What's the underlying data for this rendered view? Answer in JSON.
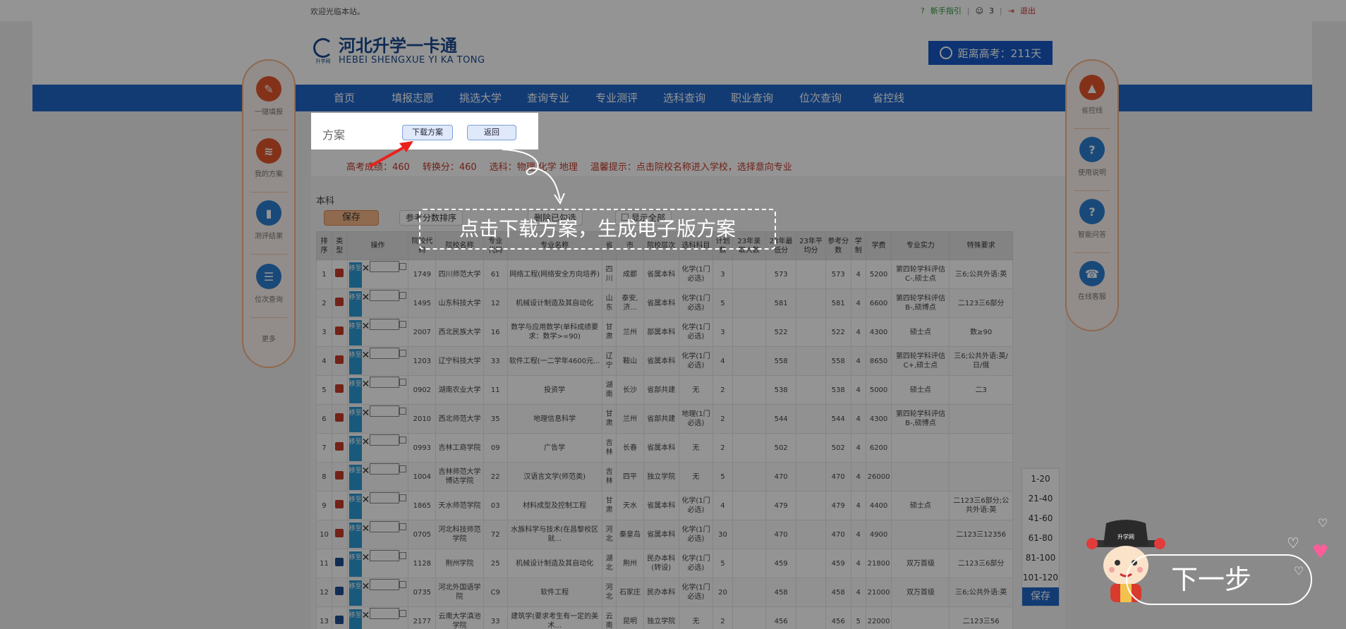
{
  "topbar": {
    "welcome": "欢迎光临本站。",
    "help": "新手指引",
    "separator": "|",
    "user_count": "3",
    "logout": "退出"
  },
  "brand": {
    "name_cn": "河北升学一卡通",
    "name_en": "HEBEI SHENGXUE YI KA TONG",
    "tagline": "升学网"
  },
  "countdown": {
    "label": "距离高考：211天"
  },
  "nav": [
    "首页",
    "填报志愿",
    "挑选大学",
    "查询专业",
    "专业测评",
    "选科查询",
    "职业查询",
    "位次查询",
    "省控线"
  ],
  "left_sidebar": [
    {
      "label": "一键填报",
      "icon": "fill-form-icon",
      "color": "#e2572b"
    },
    {
      "label": "我的方案",
      "icon": "layers-icon",
      "color": "#e2572b"
    },
    {
      "label": "测评结果",
      "icon": "bar-chart-icon",
      "color": "#2b7fd0"
    },
    {
      "label": "位次查询",
      "icon": "list-icon",
      "color": "#2b7fd0"
    },
    {
      "label": "更多",
      "icon": "",
      "color": ""
    }
  ],
  "right_sidebar": [
    {
      "label": "省控线",
      "icon": "chart-icon",
      "color": "#e2572b"
    },
    {
      "label": "使用说明",
      "icon": "question-icon",
      "color": "#2b7fd0"
    },
    {
      "label": "智能问答",
      "icon": "help-icon",
      "color": "#2b7fd0"
    },
    {
      "label": "在线客服",
      "icon": "headset-icon",
      "color": "#2b7fd0"
    }
  ],
  "plan": {
    "title": "方案",
    "download_label": "下载方案",
    "back_label": "返回"
  },
  "info": {
    "score": "高考成绩：460",
    "converted": "转换分：460",
    "subjects": "选科：物理 化学 地理",
    "hint": "温馨提示：点击院校名称进入学校，选择意向专业"
  },
  "section": {
    "title": "本科",
    "save_label": "保存",
    "btn2": "参考分数排序",
    "btn3": "删除已勾选",
    "btn4": "显示全部"
  },
  "table": {
    "headers": [
      "排序",
      "类型",
      "操作",
      "院校代码",
      "院校名称",
      "专业代码",
      "专业名称",
      "省",
      "市",
      "院校层次",
      "选科科目",
      "计划数",
      "23年录取人数",
      "23年最低分",
      "23年平均分",
      "参考分数",
      "学制",
      "学费",
      "专业实力",
      "特殊要求"
    ],
    "move_label": "移至",
    "rows": [
      {
        "rank": "1",
        "type": "r",
        "code": "1749",
        "school": "四川师范大学",
        "mcode": "61",
        "major": "网络工程(网络安全方向培养)",
        "prov": "四川",
        "city": "成都",
        "level": "省属本科",
        "subj": "化学(1门必选)",
        "plan": "3",
        "admit": "",
        "min": "573",
        "avg": "",
        "ref": "573",
        "years": "4",
        "fee": "5200",
        "strength": "第四轮学科评估C-,硕士点",
        "req": "三6;公共外语:英"
      },
      {
        "rank": "2",
        "type": "r",
        "code": "1495",
        "school": "山东科技大学",
        "mcode": "12",
        "major": "机械设计制造及其自动化",
        "prov": "山东",
        "city": "泰安,济...",
        "level": "省属本科",
        "subj": "化学(1门必选)",
        "plan": "5",
        "admit": "",
        "min": "581",
        "avg": "",
        "ref": "581",
        "years": "4",
        "fee": "6600",
        "strength": "第四轮学科评估B-,硕博点",
        "req": "二123三6部分"
      },
      {
        "rank": "3",
        "type": "r",
        "code": "2007",
        "school": "西北民族大学",
        "mcode": "16",
        "major": "数学与应用数学(单科成绩要求：数学>=90)",
        "prov": "甘肃",
        "city": "兰州",
        "level": "部属本科",
        "subj": "化学(1门必选)",
        "plan": "3",
        "admit": "",
        "min": "522",
        "avg": "",
        "ref": "522",
        "years": "4",
        "fee": "4300",
        "strength": "硕士点",
        "req": "数≥90"
      },
      {
        "rank": "4",
        "type": "r",
        "code": "1203",
        "school": "辽宁科技大学",
        "mcode": "33",
        "major": "软件工程(一二学年4600元...",
        "prov": "辽宁",
        "city": "鞍山",
        "level": "省属本科",
        "subj": "化学(1门必选)",
        "plan": "4",
        "admit": "",
        "min": "558",
        "avg": "",
        "ref": "558",
        "years": "4",
        "fee": "8650",
        "strength": "第四轮学科评估C+,硕士点",
        "req": "三6;公共外语:英/日/俄"
      },
      {
        "rank": "5",
        "type": "r",
        "code": "0902",
        "school": "湖南农业大学",
        "mcode": "11",
        "major": "投资学",
        "prov": "湖南",
        "city": "长沙",
        "level": "省部共建",
        "subj": "无",
        "plan": "2",
        "admit": "",
        "min": "538",
        "avg": "",
        "ref": "538",
        "years": "4",
        "fee": "5000",
        "strength": "硕士点",
        "req": "二3"
      },
      {
        "rank": "6",
        "type": "r",
        "code": "2010",
        "school": "西北师范大学",
        "mcode": "35",
        "major": "地理信息科学",
        "prov": "甘肃",
        "city": "兰州",
        "level": "省部共建",
        "subj": "地理(1门必选)",
        "plan": "2",
        "admit": "",
        "min": "544",
        "avg": "",
        "ref": "544",
        "years": "4",
        "fee": "4300",
        "strength": "第四轮学科评估B-,硕博点",
        "req": ""
      },
      {
        "rank": "7",
        "type": "r",
        "code": "0993",
        "school": "吉林工商学院",
        "mcode": "09",
        "major": "广告学",
        "prov": "吉林",
        "city": "长春",
        "level": "省属本科",
        "subj": "无",
        "plan": "2",
        "admit": "",
        "min": "502",
        "avg": "",
        "ref": "502",
        "years": "4",
        "fee": "6200",
        "strength": "",
        "req": ""
      },
      {
        "rank": "8",
        "type": "r",
        "code": "1004",
        "school": "吉林师范大学博达学院",
        "mcode": "22",
        "major": "汉语言文学(师范类)",
        "prov": "吉林",
        "city": "四平",
        "level": "独立学院",
        "subj": "无",
        "plan": "5",
        "admit": "",
        "min": "470",
        "avg": "",
        "ref": "470",
        "years": "4",
        "fee": "26000",
        "strength": "",
        "req": ""
      },
      {
        "rank": "9",
        "type": "r",
        "code": "1865",
        "school": "天水师范学院",
        "mcode": "03",
        "major": "材料成型及控制工程",
        "prov": "甘肃",
        "city": "天水",
        "level": "省属本科",
        "subj": "化学(1门必选)",
        "plan": "4",
        "admit": "",
        "min": "479",
        "avg": "",
        "ref": "479",
        "years": "4",
        "fee": "4400",
        "strength": "硕士点",
        "req": "二123三6部分;公共外语:英"
      },
      {
        "rank": "10",
        "type": "r",
        "code": "0705",
        "school": "河北科技师范学院",
        "mcode": "72",
        "major": "水族科学与技术(在昌黎校区就...",
        "prov": "河北",
        "city": "秦皇岛",
        "level": "省属本科",
        "subj": "化学(1门必选)",
        "plan": "30",
        "admit": "",
        "min": "470",
        "avg": "",
        "ref": "470",
        "years": "4",
        "fee": "4900",
        "strength": "",
        "req": "二123三12356"
      },
      {
        "rank": "11",
        "type": "b",
        "code": "1128",
        "school": "荆州学院",
        "mcode": "25",
        "major": "机械设计制造及其自动化",
        "prov": "湖北",
        "city": "荆州",
        "level": "民办本科(转设)",
        "subj": "化学(1门必选)",
        "plan": "5",
        "admit": "",
        "min": "459",
        "avg": "",
        "ref": "459",
        "years": "4",
        "fee": "21800",
        "strength": "双万首级",
        "req": "二123三6部分"
      },
      {
        "rank": "12",
        "type": "b",
        "code": "0735",
        "school": "河北外国语学院",
        "mcode": "C9",
        "major": "软件工程",
        "prov": "河北",
        "city": "石家庄",
        "level": "民办本科",
        "subj": "化学(1门必选)",
        "plan": "20",
        "admit": "",
        "min": "458",
        "avg": "",
        "ref": "458",
        "years": "4",
        "fee": "21000",
        "strength": "双万首级",
        "req": "三6;公共外语:英"
      },
      {
        "rank": "13",
        "type": "b",
        "code": "2177",
        "school": "云南大学滇池学院",
        "mcode": "33",
        "major": "建筑学(要求考生有一定的美术...",
        "prov": "云南",
        "city": "昆明",
        "level": "独立学院",
        "subj": "无",
        "plan": "2",
        "admit": "",
        "min": "456",
        "avg": "",
        "ref": "456",
        "years": "5",
        "fee": "22000",
        "strength": "",
        "req": "二123三56"
      }
    ]
  },
  "pager": {
    "ranges": [
      "1-20",
      "21-40",
      "41-60",
      "61-80",
      "81-100",
      "101-120"
    ],
    "save_label": "保存"
  },
  "guide": {
    "tip": "点击下载方案，生成电子版方案",
    "next_label": "下一步",
    "mascot_badge": "升学网"
  },
  "colors": {
    "primary": "#1f67c9",
    "accent": "#e2572b",
    "danger": "#d2322d"
  }
}
